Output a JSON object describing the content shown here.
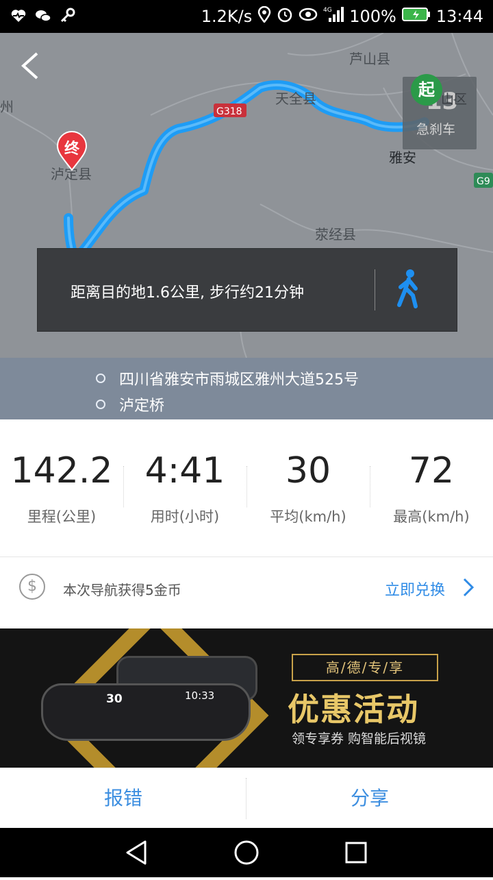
{
  "status_bar": {
    "net_speed": "1.2K/s",
    "battery": "100%",
    "time": "13:44"
  },
  "map": {
    "places": {
      "lushan": "芦山县",
      "tianquan": "天全县",
      "yaan": "雅安",
      "luding": "泸定县",
      "yingjing": "荥经县",
      "zhou_fragment": "州",
      "shan_qu_fragment": "山区",
      "road_g318": "G318",
      "road_g9": "G9"
    },
    "start_pin": "起",
    "end_pin": "终",
    "event": {
      "count": "13",
      "label": "急刹车"
    },
    "walk_panel": {
      "message": "距离目的地1.6公里, 步行约21分钟"
    }
  },
  "route": {
    "origin": "四川省雅安市雨城区雅州大道525号",
    "destination": "泸定桥"
  },
  "stats": [
    {
      "value": "142.2",
      "label": "里程(公里)"
    },
    {
      "value": "4:41",
      "label": "用时(小时)"
    },
    {
      "value": "30",
      "label": "平均(km/h)"
    },
    {
      "value": "72",
      "label": "最高(km/h)"
    }
  ],
  "coins": {
    "message": "本次导航获得5金币",
    "link": "立即兑换"
  },
  "banner": {
    "tag": "高/德/专/享",
    "title": "优惠活动",
    "subtitle": "领专享券 购智能后视镜",
    "speed": "30",
    "time": "10:33"
  },
  "actions": {
    "report": "报错",
    "share": "分享"
  },
  "colors": {
    "route": "#1e9cf5",
    "accent": "#2f8be6",
    "map_bg": "#8f9398",
    "address_band": "#7e8a9a"
  }
}
